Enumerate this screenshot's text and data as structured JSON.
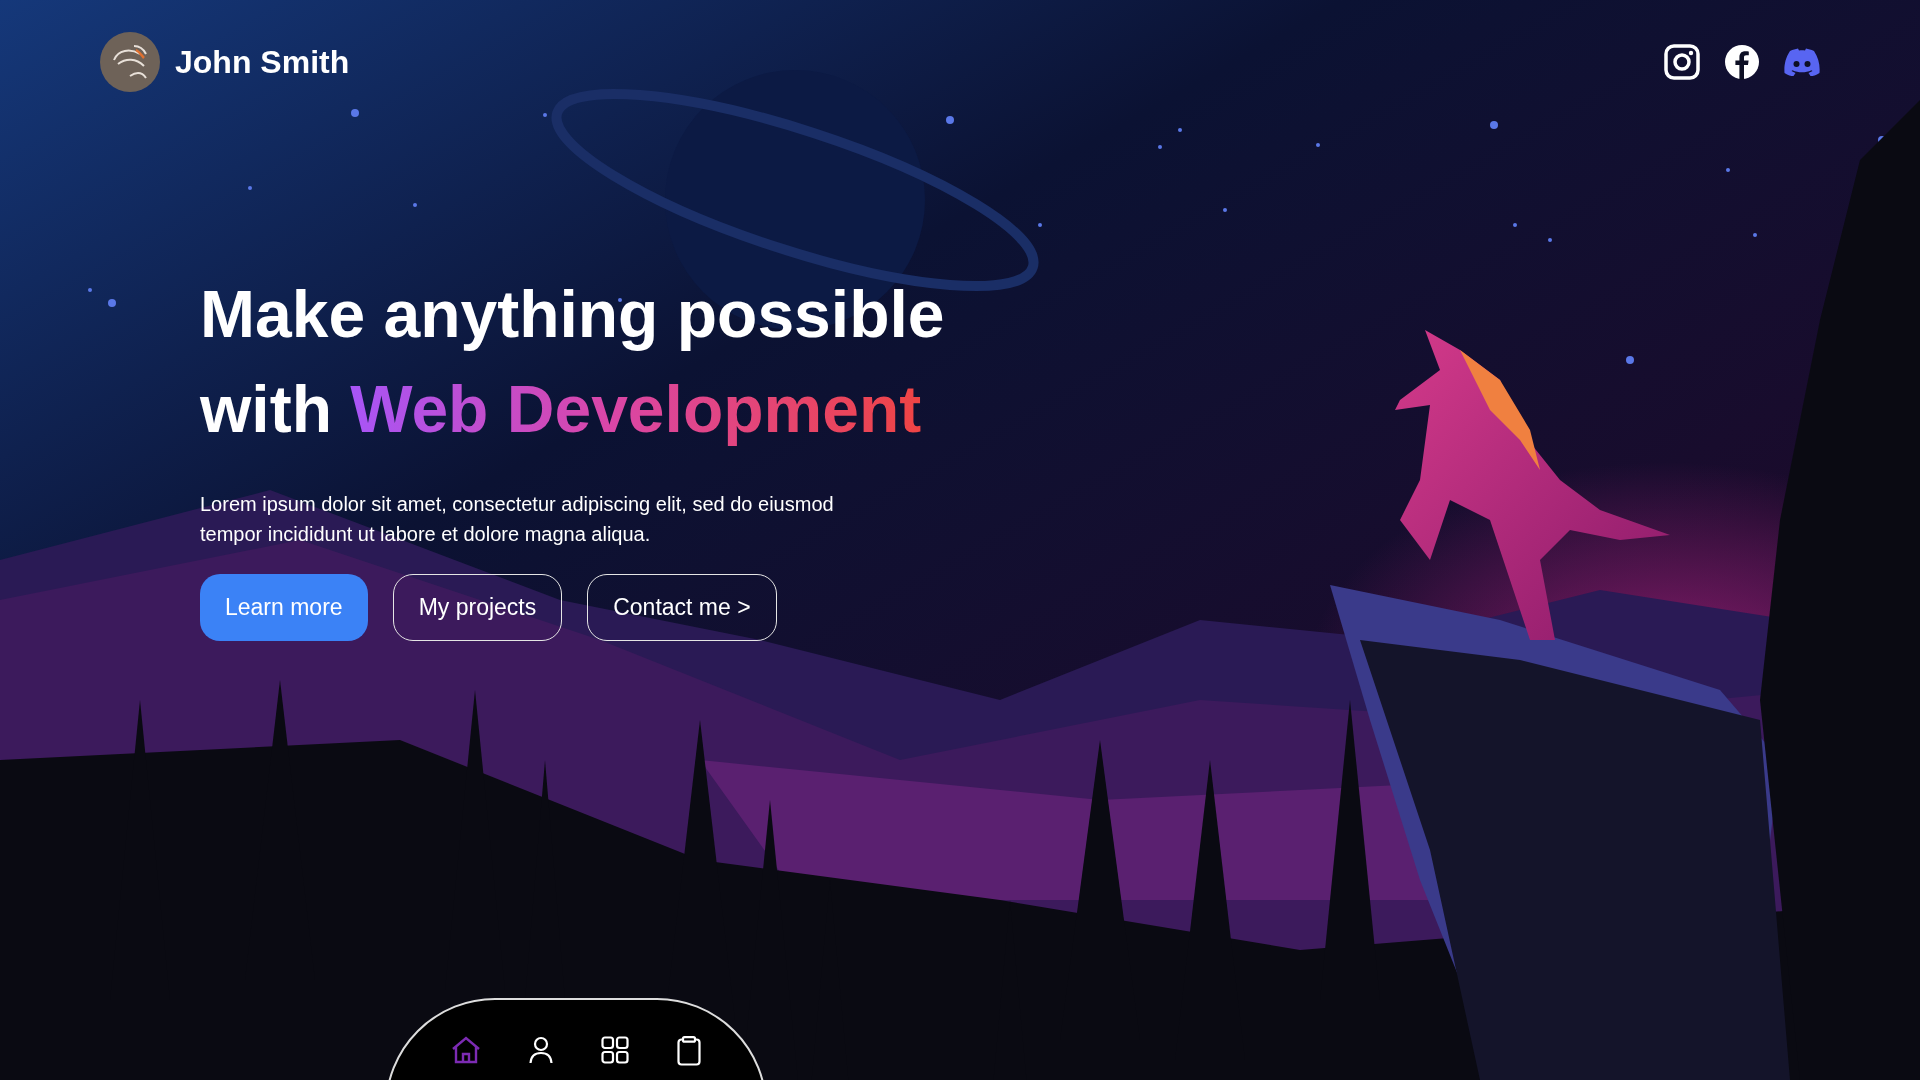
{
  "header": {
    "name": "John Smith"
  },
  "socials": [
    {
      "kind": "instagram"
    },
    {
      "kind": "facebook"
    },
    {
      "kind": "discord"
    }
  ],
  "hero": {
    "title_line_1": "Make anything possible",
    "title_line_2": "with",
    "title_highlight": "Web Development",
    "text": "Lorem ipsum dolor sit amet, consectetur adipiscing elit, sed do eiusmod tempor incididunt ut labore et dolore magna aliqua."
  },
  "buttons": [
    {
      "label": "Learn more",
      "kind": "primary"
    },
    {
      "label": "My projects",
      "kind": "outline"
    },
    {
      "label": "Contact me >",
      "kind": "outline"
    }
  ],
  "nav": [
    {
      "kind": "home",
      "selected": true
    },
    {
      "kind": "profile",
      "selected": false
    },
    {
      "kind": "grid",
      "selected": false
    },
    {
      "kind": "clipboard",
      "selected": false
    }
  ]
}
